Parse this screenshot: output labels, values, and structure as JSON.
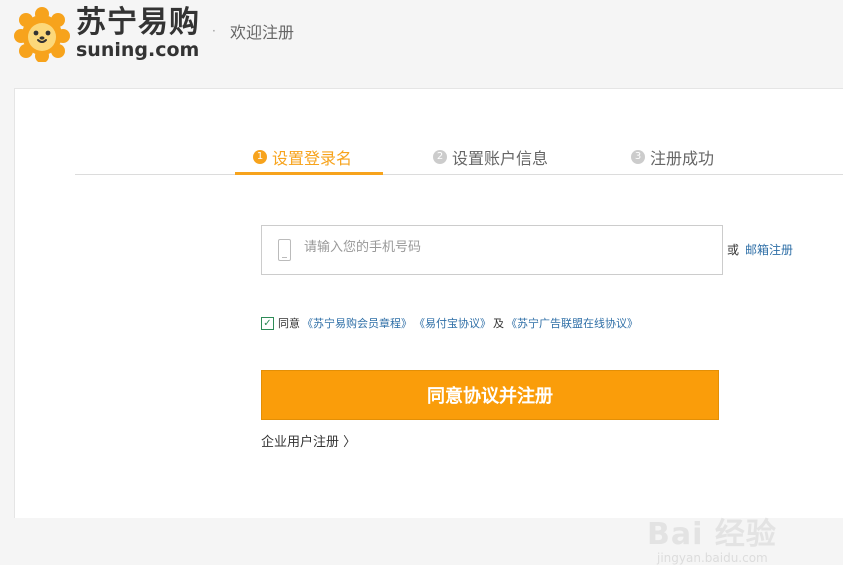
{
  "header": {
    "logo_cn": "苏宁易购",
    "logo_en": "suning.com",
    "separator": "·",
    "welcome": "欢迎注册"
  },
  "steps": [
    {
      "num": "1",
      "label": "设置登录名",
      "active": true
    },
    {
      "num": "2",
      "label": "设置账户信息",
      "active": false
    },
    {
      "num": "3",
      "label": "注册成功",
      "active": false
    }
  ],
  "form": {
    "phone_placeholder": "请输入您的手机号码",
    "phone_value": "",
    "or_text": "或",
    "email_register": "邮箱注册",
    "agree_prefix": "同意",
    "agreement_1": "《苏宁易购会员章程》",
    "agreement_2": "《易付宝协议》",
    "and_text": "及",
    "agreement_3": "《苏宁广告联盟在线协议》",
    "agree_checked": true,
    "submit_label": "同意协议并注册",
    "enterprise_register": "企业用户注册 〉"
  },
  "watermark": {
    "top": "Bai  经验",
    "bottom": "jingyan.baidu.com"
  },
  "colors": {
    "accent": "#f7a31c",
    "button": "#fa9d0a",
    "link": "#2f6fa7",
    "checkbox": "#2e8b57"
  }
}
